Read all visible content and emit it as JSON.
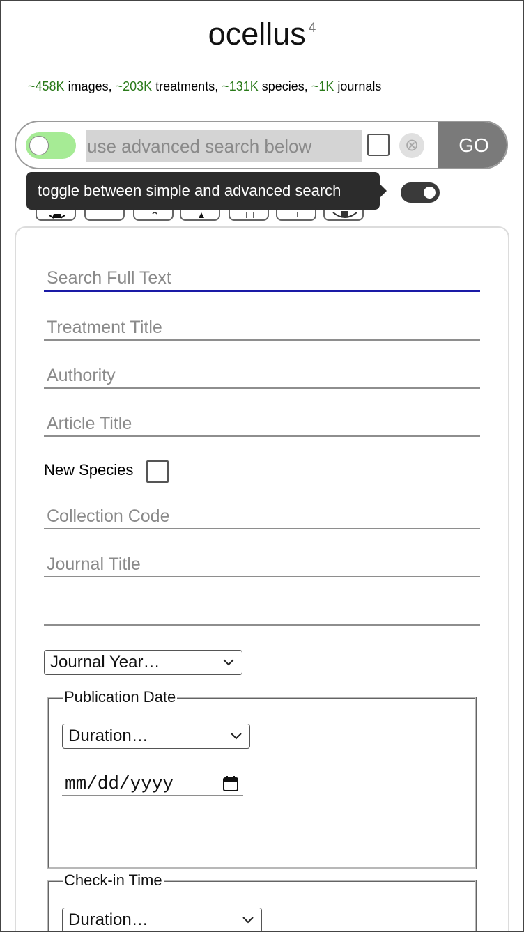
{
  "header": {
    "title": "ocellus",
    "version": "4"
  },
  "stats": {
    "images_num": "~458K",
    "images_label": " images, ",
    "treatments_num": "~203K",
    "treatments_label": " treatments, ",
    "species_num": "~131K",
    "species_label": " species, ",
    "journals_num": "~1K",
    "journals_label": " journals"
  },
  "search": {
    "placeholder": "use advanced search below",
    "reset_icon": "⊗",
    "go_label": "GO"
  },
  "tooltip": {
    "text": "toggle between simple and advanced search"
  },
  "icons": [
    "bug-icon",
    "blank-icon",
    "leaf-icon",
    "figure-icon",
    "chart-icon",
    "arrow-icon",
    "eye-icon"
  ],
  "advanced": {
    "fulltext_placeholder": "Search Full Text",
    "treatment_title_placeholder": "Treatment Title",
    "authority_placeholder": "Authority",
    "article_title_placeholder": "Article Title",
    "new_species_label": "New Species",
    "collection_code_placeholder": "Collection Code",
    "journal_title_placeholder": "Journal Title",
    "extra_placeholder": "",
    "journal_year": "Journal Year…",
    "publication_date": {
      "legend": "Publication Date",
      "duration": "Duration…",
      "date_placeholder": "mm/dd/yyyy"
    },
    "checkin_time": {
      "legend": "Check-in Time",
      "duration": "Duration…"
    }
  },
  "colors": {
    "stat_number": "#2a7a1a",
    "toggle_on": "#a6eb95",
    "go_button": "#7a7a7a",
    "tooltip_bg": "#2c2c2c",
    "active_underline": "#1a1aa6"
  }
}
